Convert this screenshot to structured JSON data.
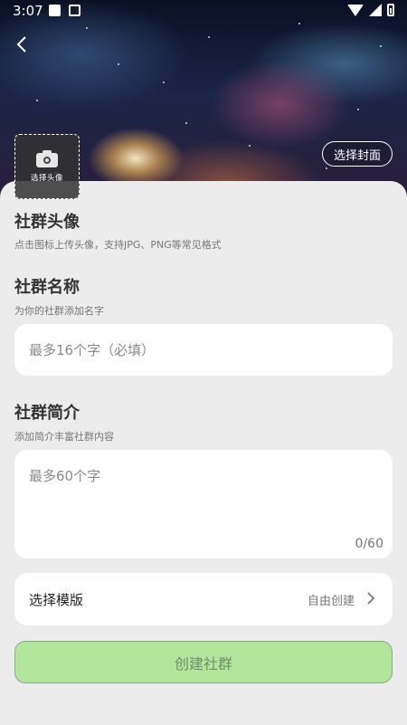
{
  "status_bar": {
    "time": "3:07"
  },
  "header": {
    "cover_button_label": "选择封面",
    "avatar_button_label": "选择头像"
  },
  "avatar_section": {
    "title": "社群头像",
    "hint": "点击图标上传头像，支持JPG、PNG等常见格式"
  },
  "name_section": {
    "title": "社群名称",
    "hint": "为你的社群添加名字",
    "placeholder": "最多16个字（必填）"
  },
  "intro_section": {
    "title": "社群简介",
    "hint": "添加简介丰富社群内容",
    "placeholder": "最多60个字",
    "counter": "0/60"
  },
  "template": {
    "label": "选择模版",
    "value": "自由创建"
  },
  "create_button_label": "创建社群",
  "colors": {
    "background": "#ececec",
    "card": "#ffffff",
    "create_button": "#b3e69d"
  }
}
